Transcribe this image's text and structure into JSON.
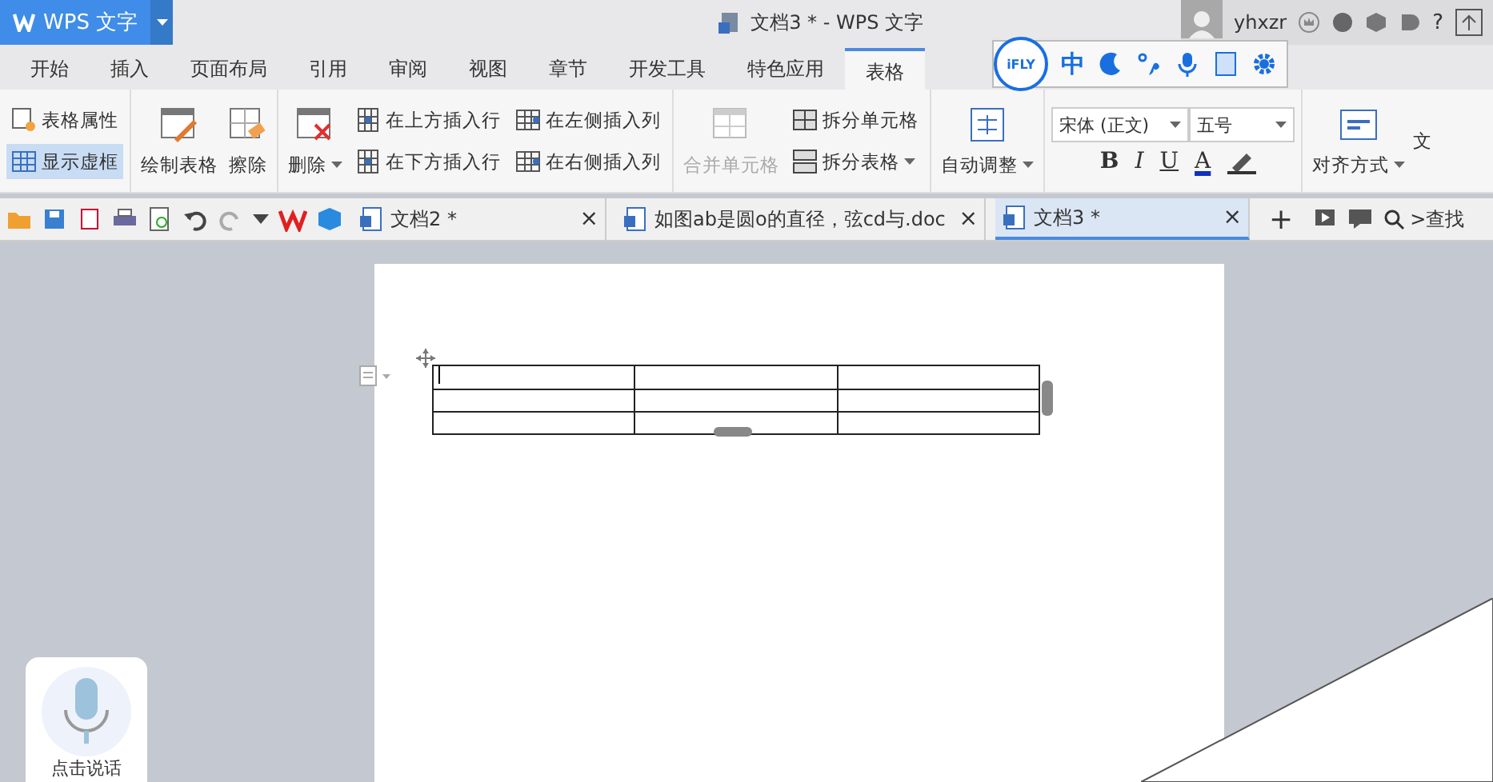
{
  "app": {
    "logo": "WPS 文字",
    "title": "文档3 * - WPS 文字"
  },
  "user": {
    "name": "yhxzr",
    "help": "?"
  },
  "tabs": [
    {
      "label": "开始",
      "selected": false
    },
    {
      "label": "插入",
      "selected": false
    },
    {
      "label": "页面布局",
      "selected": false
    },
    {
      "label": "引用",
      "selected": false
    },
    {
      "label": "审阅",
      "selected": false
    },
    {
      "label": "视图",
      "selected": false
    },
    {
      "label": "章节",
      "selected": false
    },
    {
      "label": "开发工具",
      "selected": false
    },
    {
      "label": "特色应用",
      "selected": false
    },
    {
      "label": "表格",
      "selected": true
    }
  ],
  "ime_toolbar": {
    "badge": "iFLY",
    "mode": "中"
  },
  "ribbon": {
    "table_props": "表格属性",
    "gridlines": {
      "label": "显示虚框",
      "on": true
    },
    "draw_table": "绘制表格",
    "erase": "擦除",
    "delete": "删除",
    "insert_rows": [
      "在上方插入行",
      "在下方插入行"
    ],
    "insert_cols": [
      "在左侧插入列",
      "在右侧插入列"
    ],
    "merge_cells": {
      "label": "合并单元格",
      "disabled": true
    },
    "split_cells": "拆分单元格",
    "split_table": "拆分表格",
    "autofit": "自动调整",
    "font": "宋体 (正文)",
    "size": "五号",
    "format": [
      "B",
      "I",
      "U",
      "A"
    ],
    "align": "对齐方式",
    "more": "文"
  },
  "doc_tabs": [
    {
      "label": "文档2 *",
      "selected": false,
      "close": "×"
    },
    {
      "label": "如图ab是圆o的直径，弦cd与.doc",
      "selected": false,
      "close": "×"
    },
    {
      "label": "文档3 *",
      "selected": true,
      "close": "×"
    }
  ],
  "new_tab": "+",
  "search": ">查找",
  "voice": {
    "label": "点击说话"
  }
}
